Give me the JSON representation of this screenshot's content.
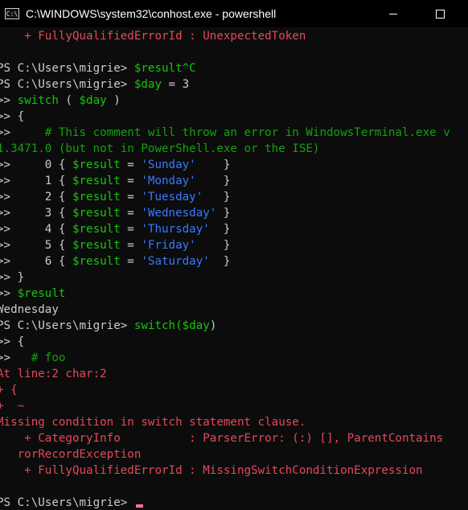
{
  "window": {
    "title": "C:\\WINDOWS\\system32\\conhost.exe - powershell",
    "icon_label": "C:\\"
  },
  "terminal": {
    "lines": [
      {
        "segments": [
          {
            "t": "    + FullyQualifiedErrorId : UnexpectedToken",
            "c": "err"
          }
        ]
      },
      {
        "segments": []
      },
      {
        "segments": [
          {
            "t": "PS C:\\Users\\migrie> ",
            "c": "wht"
          },
          {
            "t": "$result^C",
            "c": "grn"
          }
        ]
      },
      {
        "segments": [
          {
            "t": "PS C:\\Users\\migrie> ",
            "c": "wht"
          },
          {
            "t": "$day",
            "c": "grn"
          },
          {
            "t": " = 3",
            "c": "wht"
          }
        ]
      },
      {
        "segments": [
          {
            "t": ">> ",
            "c": "wht"
          },
          {
            "t": "switch",
            "c": "grn"
          },
          {
            "t": " ( ",
            "c": "wht"
          },
          {
            "t": "$day",
            "c": "grn"
          },
          {
            "t": " )",
            "c": "wht"
          }
        ]
      },
      {
        "segments": [
          {
            "t": ">> {",
            "c": "wht"
          }
        ]
      },
      {
        "segments": [
          {
            "t": ">>     ",
            "c": "wht"
          },
          {
            "t": "# This comment will throw an error in WindowsTerminal.exe v",
            "c": "cmt"
          }
        ]
      },
      {
        "segments": [
          {
            "t": "1.3471.0 (but not in PowerShell.exe or the ISE)",
            "c": "cmt"
          }
        ]
      },
      {
        "segments": [
          {
            "t": ">>     0 { ",
            "c": "wht"
          },
          {
            "t": "$result",
            "c": "grn"
          },
          {
            "t": " = ",
            "c": "wht"
          },
          {
            "t": "'Sunday'",
            "c": "str"
          },
          {
            "t": "    }",
            "c": "wht"
          }
        ]
      },
      {
        "segments": [
          {
            "t": ">>     1 { ",
            "c": "wht"
          },
          {
            "t": "$result",
            "c": "grn"
          },
          {
            "t": " = ",
            "c": "wht"
          },
          {
            "t": "'Monday'",
            "c": "str"
          },
          {
            "t": "    }",
            "c": "wht"
          }
        ]
      },
      {
        "segments": [
          {
            "t": ">>     2 { ",
            "c": "wht"
          },
          {
            "t": "$result",
            "c": "grn"
          },
          {
            "t": " = ",
            "c": "wht"
          },
          {
            "t": "'Tuesday'",
            "c": "str"
          },
          {
            "t": "   }",
            "c": "wht"
          }
        ]
      },
      {
        "segments": [
          {
            "t": ">>     3 { ",
            "c": "wht"
          },
          {
            "t": "$result",
            "c": "grn"
          },
          {
            "t": " = ",
            "c": "wht"
          },
          {
            "t": "'Wednesday'",
            "c": "str"
          },
          {
            "t": " }",
            "c": "wht"
          }
        ]
      },
      {
        "segments": [
          {
            "t": ">>     4 { ",
            "c": "wht"
          },
          {
            "t": "$result",
            "c": "grn"
          },
          {
            "t": " = ",
            "c": "wht"
          },
          {
            "t": "'Thursday'",
            "c": "str"
          },
          {
            "t": "  }",
            "c": "wht"
          }
        ]
      },
      {
        "segments": [
          {
            "t": ">>     5 { ",
            "c": "wht"
          },
          {
            "t": "$result",
            "c": "grn"
          },
          {
            "t": " = ",
            "c": "wht"
          },
          {
            "t": "'Friday'",
            "c": "str"
          },
          {
            "t": "    }",
            "c": "wht"
          }
        ]
      },
      {
        "segments": [
          {
            "t": ">>     6 { ",
            "c": "wht"
          },
          {
            "t": "$result",
            "c": "grn"
          },
          {
            "t": " = ",
            "c": "wht"
          },
          {
            "t": "'Saturday'",
            "c": "str"
          },
          {
            "t": "  }",
            "c": "wht"
          }
        ]
      },
      {
        "segments": [
          {
            "t": ">> }",
            "c": "wht"
          }
        ]
      },
      {
        "segments": [
          {
            "t": ">> ",
            "c": "wht"
          },
          {
            "t": "$result",
            "c": "grn"
          }
        ]
      },
      {
        "segments": [
          {
            "t": "Wednesday",
            "c": "wht"
          }
        ]
      },
      {
        "segments": [
          {
            "t": "PS C:\\Users\\migrie> ",
            "c": "wht"
          },
          {
            "t": "switch(",
            "c": "grn"
          },
          {
            "t": "$day",
            "c": "grn"
          },
          {
            "t": ")",
            "c": "wht"
          }
        ]
      },
      {
        "segments": [
          {
            "t": ">> {",
            "c": "wht"
          }
        ]
      },
      {
        "segments": [
          {
            "t": ">>   ",
            "c": "wht"
          },
          {
            "t": "# foo",
            "c": "cmt"
          }
        ]
      },
      {
        "segments": [
          {
            "t": "At line:2 char:2",
            "c": "err"
          }
        ]
      },
      {
        "segments": [
          {
            "t": "+ {",
            "c": "err"
          }
        ]
      },
      {
        "segments": [
          {
            "t": "+  ~",
            "c": "err"
          }
        ]
      },
      {
        "segments": [
          {
            "t": "Missing condition in switch statement clause.",
            "c": "err"
          }
        ]
      },
      {
        "segments": [
          {
            "t": "    + CategoryInfo          : ParserError: (:) [], ParentContains",
            "c": "err"
          }
        ]
      },
      {
        "segments": [
          {
            "t": "   rorRecordException",
            "c": "err"
          }
        ]
      },
      {
        "segments": [
          {
            "t": "    + FullyQualifiedErrorId : MissingSwitchConditionExpression",
            "c": "err"
          }
        ]
      },
      {
        "segments": []
      },
      {
        "segments": [
          {
            "t": "PS C:\\Users\\migrie> ",
            "c": "wht"
          }
        ],
        "cursor": true
      }
    ]
  },
  "icons": {
    "app": "console-app-icon",
    "minimize": "minimize-icon",
    "maximize": "maximize-icon"
  },
  "colors": {
    "background": "#0c0c0c",
    "foreground": "#cccccc",
    "error": "#e74856",
    "keyword": "#16c60c",
    "comment": "#13a10e",
    "string": "#3b78ff",
    "cursor": "#ff6fa0"
  }
}
